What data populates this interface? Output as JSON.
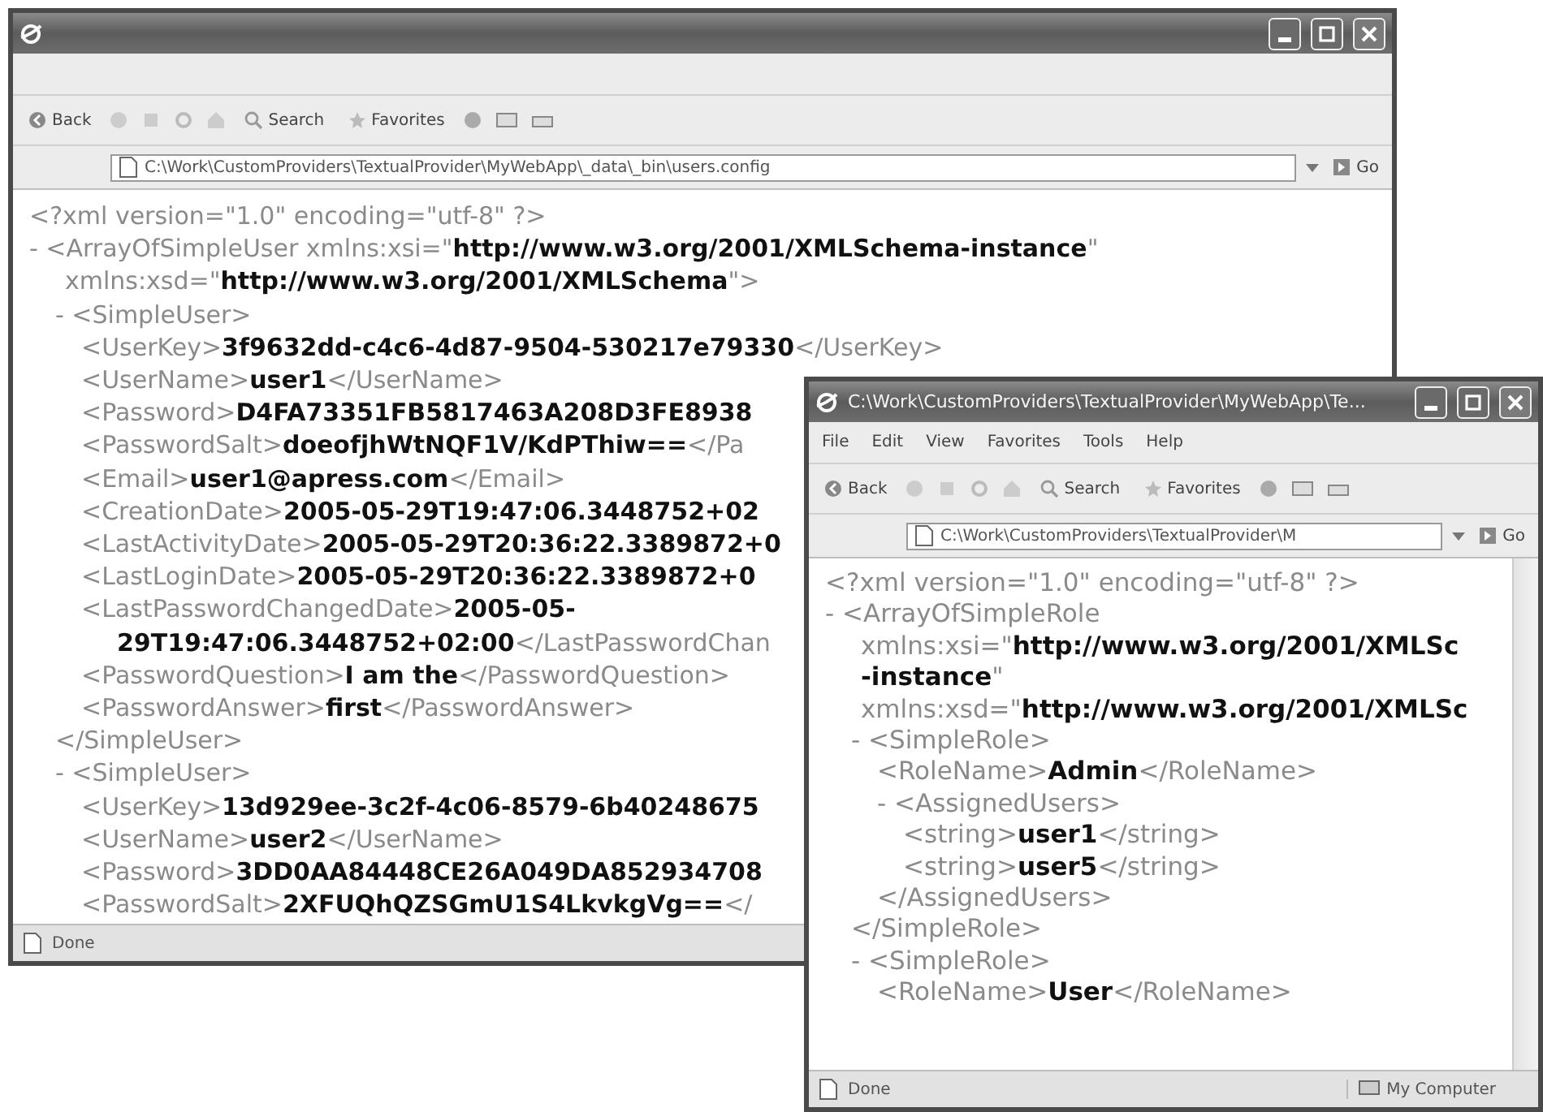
{
  "windows": [
    {
      "kind": "browser",
      "toolbar": {
        "back": "Back",
        "search": "Search",
        "favorites": "Favorites"
      },
      "address": "C:\\Work\\CustomProviders\\TextualProvider\\MyWebApp\\_data\\_bin\\users.config",
      "go": "Go",
      "tree": [
        {
          "lines": [
            "<?xml version=\"1.0\" encoding=\"utf-8\" ?>"
          ]
        },
        {
          "lines": [
            "- <ArrayOfSimpleUser xmlns:xsi=\"**http://www.w3.org/2001/XMLSchema-instance**\"",
            "xmlns:xsd=\"**http://www.w3.org/2001/XMLSchema**\">"
          ],
          "children": [
            {
              "lines": [
                "- <SimpleUser>"
              ],
              "children": [
                {
                  "lines": [
                    "<UserKey>**3f9632dd-c4c6-4d87-9504-530217e79330**</UserKey>"
                  ]
                },
                {
                  "lines": [
                    "<UserName>**user1**</UserName>"
                  ]
                },
                {
                  "lines": [
                    "<Password>**D4FA73351FB5817463A208D3FE8938**"
                  ]
                },
                {
                  "lines": [
                    "<PasswordSalt>**doeofjhWtNQF1V/KdPThiw==**</Pa"
                  ]
                },
                {
                  "lines": [
                    "<Email>**user1@apress.com**</Email>"
                  ]
                },
                {
                  "lines": [
                    "<CreationDate>**2005-05-29T19:47:06.3448752+02**"
                  ]
                },
                {
                  "lines": [
                    "<LastActivityDate>**2005-05-29T20:36:22.3389872+0**"
                  ]
                },
                {
                  "lines": [
                    "<LastLoginDate>**2005-05-29T20:36:22.3389872+0**"
                  ]
                },
                {
                  "lines": [
                    "<LastPasswordChangedDate>**2005-05-**",
                    "**29T19:47:06.3448752+02:00**</LastPasswordChan"
                  ]
                },
                {
                  "lines": [
                    "<PasswordQuestion>**I am the**</PasswordQuestion>"
                  ]
                },
                {
                  "lines": [
                    "<PasswordAnswer>**first**</PasswordAnswer>"
                  ]
                }
              ]
            },
            {
              "lines": [
                "</SimpleUser>"
              ]
            },
            {
              "lines": [
                "- <SimpleUser>"
              ],
              "children": [
                {
                  "lines": [
                    "<UserKey>**13d929ee-3c2f-4c06-8579-6b40248675**"
                  ]
                },
                {
                  "lines": [
                    "<UserName>**user2**</UserName>"
                  ]
                },
                {
                  "lines": [
                    "<Password>**3DD0AA84448CE26A049DA852934708**"
                  ]
                },
                {
                  "lines": [
                    "<PasswordSalt>**2XFUQhQZSGmU1S4LkvkgVg==**</"
                  ]
                }
              ]
            }
          ]
        }
      ],
      "status": [
        "Done"
      ]
    },
    {
      "kind": "browser",
      "title": "C:\\Work\\CustomProviders\\TextualProvider\\MyWebApp\\Te...",
      "menu": [
        "File",
        "Edit",
        "View",
        "Favorites",
        "Tools",
        "Help"
      ],
      "toolbar": {
        "back": "Back",
        "search": "Search",
        "favorites": "Favorites"
      },
      "address": "C:\\Work\\CustomProviders\\TextualProvider\\M",
      "go": "Go",
      "tree": [
        {
          "lines": [
            "<?xml version=\"1.0\" encoding=\"utf-8\" ?>"
          ]
        },
        {
          "lines": [
            "- <ArrayOfSimpleRole",
            "xmlns:xsi=\"**http://www.w3.org/2001/XMLSc**",
            "**-instance**\"",
            "xmlns:xsd=\"**http://www.w3.org/2001/XMLSc**"
          ],
          "children": [
            {
              "lines": [
                "- <SimpleRole>"
              ],
              "children": [
                {
                  "lines": [
                    "<RoleName>**Admin**</RoleName>"
                  ]
                },
                {
                  "lines": [
                    "- <AssignedUsers>"
                  ],
                  "children": [
                    {
                      "lines": [
                        "<string>**user1**</string>"
                      ]
                    },
                    {
                      "lines": [
                        "<string>**user5**</string>"
                      ]
                    }
                  ]
                },
                {
                  "lines": [
                    "</AssignedUsers>"
                  ]
                }
              ]
            },
            {
              "lines": [
                "</SimpleRole>"
              ]
            },
            {
              "lines": [
                "- <SimpleRole>"
              ],
              "children": [
                {
                  "lines": [
                    "<RoleName>**User**</RoleName>"
                  ]
                }
              ]
            }
          ]
        }
      ],
      "status": [
        "Done",
        "My Computer"
      ]
    }
  ]
}
